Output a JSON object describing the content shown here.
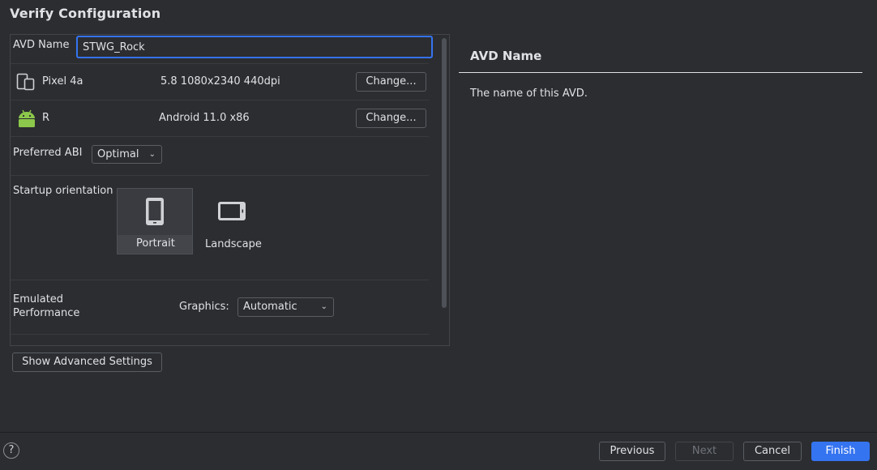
{
  "dialog": {
    "title": "Verify Configuration"
  },
  "form": {
    "avd_name_label": "AVD Name",
    "avd_name_value": "STWG_Rock",
    "device": {
      "name": "Pixel 4a",
      "spec": "5.8 1080x2340 440dpi",
      "change_label": "Change..."
    },
    "system_image": {
      "name": "R",
      "spec": "Android 11.0 x86",
      "change_label": "Change..."
    },
    "abi": {
      "label": "Preferred ABI",
      "selected": "Optimal"
    },
    "orientation": {
      "label": "Startup orientation",
      "portrait": "Portrait",
      "landscape": "Landscape",
      "selected": "Portrait"
    },
    "performance": {
      "label_line1": "Emulated",
      "label_line2": "Performance",
      "graphics_label": "Graphics:",
      "graphics_selected": "Automatic"
    },
    "advanced_button": "Show Advanced Settings"
  },
  "help_panel": {
    "title": "AVD Name",
    "description": "The name of this AVD."
  },
  "footer": {
    "help_glyph": "?",
    "previous": "Previous",
    "next": "Next",
    "cancel": "Cancel",
    "finish": "Finish"
  },
  "colors": {
    "accent": "#3574f0",
    "android_green": "#8cc84b",
    "background": "#2b2d30"
  }
}
